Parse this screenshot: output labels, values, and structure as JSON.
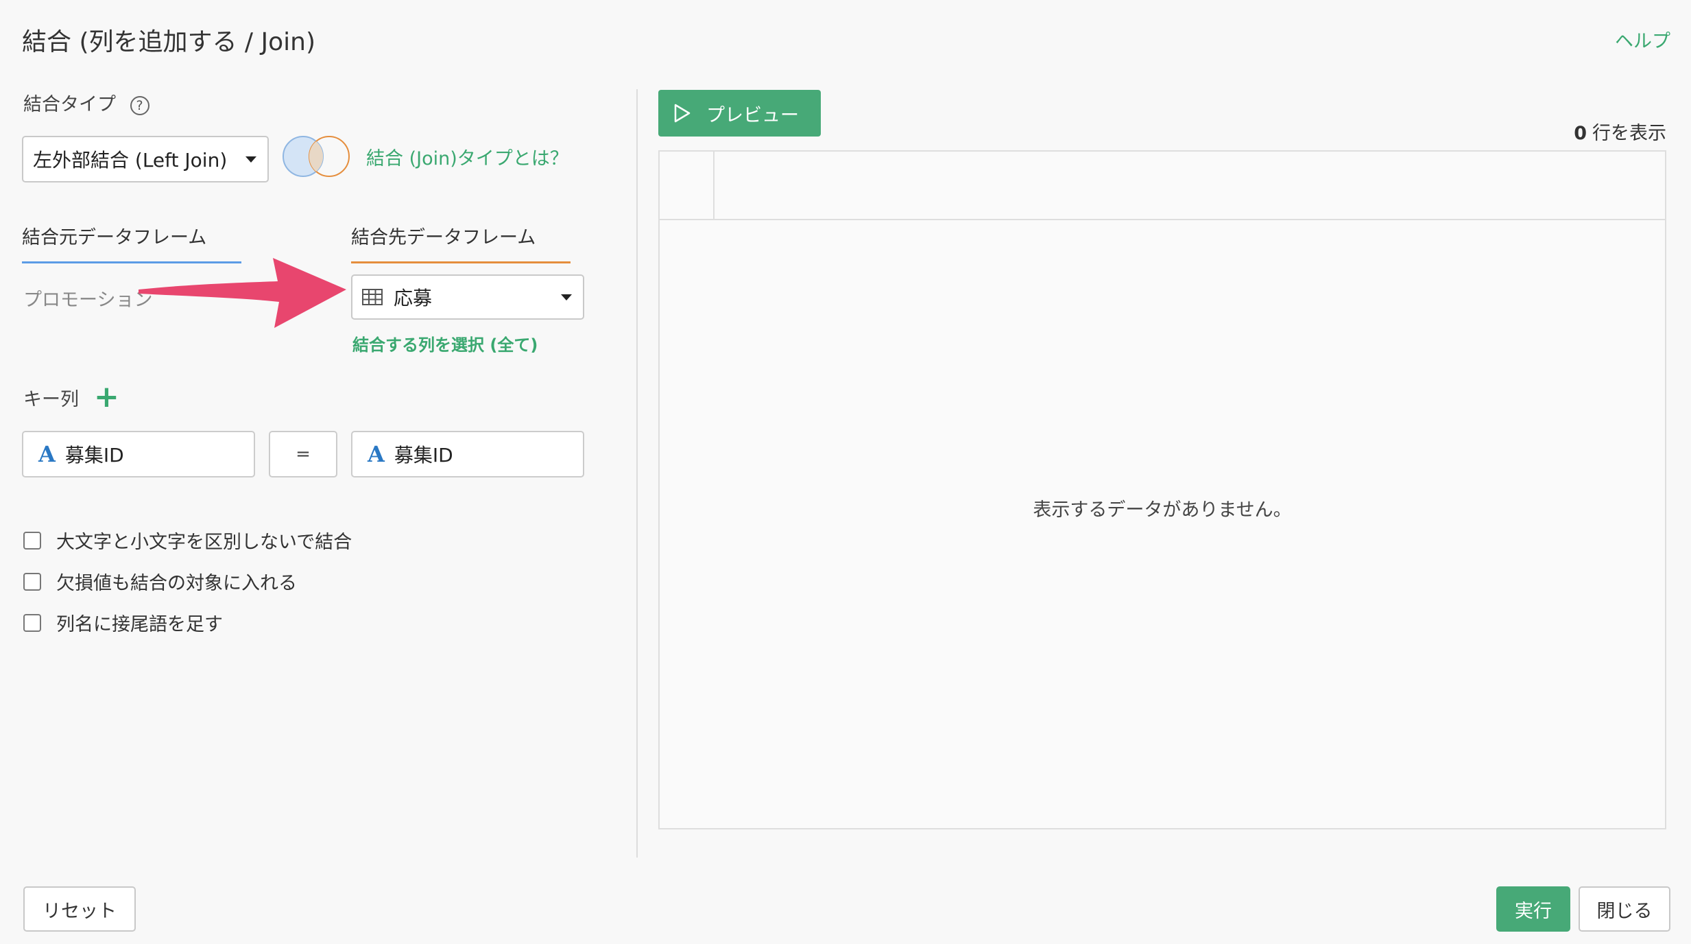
{
  "header": {
    "title": "結合 (列を追加する / Join)",
    "help_label": "ヘルプ"
  },
  "join_type": {
    "label": "結合タイプ",
    "help_icon": "?",
    "selected": "左外部結合 (Left Join)",
    "info_link": "結合 (Join)タイプとは？"
  },
  "dataframes": {
    "source_tab": "結合元データフレーム",
    "target_tab": "結合先データフレーム",
    "source_name": "プロモーション",
    "target_selected": "応募",
    "select_columns_link": "結合する列を選択 (全て)"
  },
  "keys": {
    "label": "キー列",
    "add_icon": "+",
    "type_glyph": "A",
    "left_column": "募集ID",
    "operator": "=",
    "right_column": "募集ID"
  },
  "options": [
    {
      "label": "大文字と小文字を区別しないで結合",
      "checked": false
    },
    {
      "label": "欠損値も結合の対象に入れる",
      "checked": false
    },
    {
      "label": "列名に接尾語を足す",
      "checked": false
    }
  ],
  "preview": {
    "button_label": "プレビュー",
    "row_count": "0",
    "row_count_suffix": "行を表示",
    "empty_message": "表示するデータがありません。"
  },
  "footer": {
    "reset_label": "リセット",
    "run_label": "実行",
    "close_label": "閉じる"
  },
  "colors": {
    "accent_green": "#47a977",
    "source_underline": "#5c9ce6",
    "target_underline": "#e58e3d",
    "arrow": "#e8466e"
  }
}
